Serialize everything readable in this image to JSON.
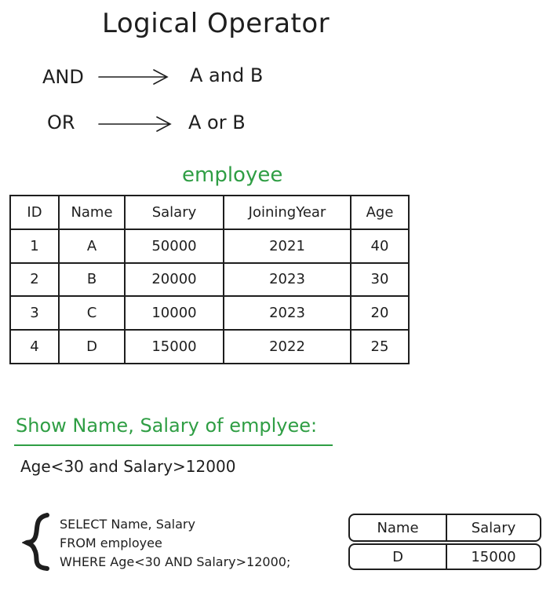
{
  "title": "Logical Operator",
  "operators": [
    {
      "name": "AND",
      "meaning": "A and B"
    },
    {
      "name": "OR",
      "meaning": "A or B"
    }
  ],
  "table_title": "employee",
  "employee": {
    "headers": [
      "ID",
      "Name",
      "Salary",
      "JoiningYear",
      "Age"
    ],
    "rows": [
      [
        "1",
        "A",
        "50000",
        "2021",
        "40"
      ],
      [
        "2",
        "B",
        "20000",
        "2023",
        "30"
      ],
      [
        "3",
        "C",
        "10000",
        "2023",
        "20"
      ],
      [
        "4",
        "D",
        "15000",
        "2022",
        "25"
      ]
    ]
  },
  "question": "Show Name, Salary of emplyee:",
  "condition": "Age<30 and Salary>12000",
  "sql": {
    "line1": "SELECT Name, Salary",
    "line2": "FROM employee",
    "line3": "WHERE Age<30 AND Salary>12000;"
  },
  "result": {
    "headers": [
      "Name",
      "Salary"
    ],
    "row": [
      "D",
      "15000"
    ]
  },
  "colors": {
    "text": "#1e1e1e",
    "accent": "#2f9e44"
  }
}
